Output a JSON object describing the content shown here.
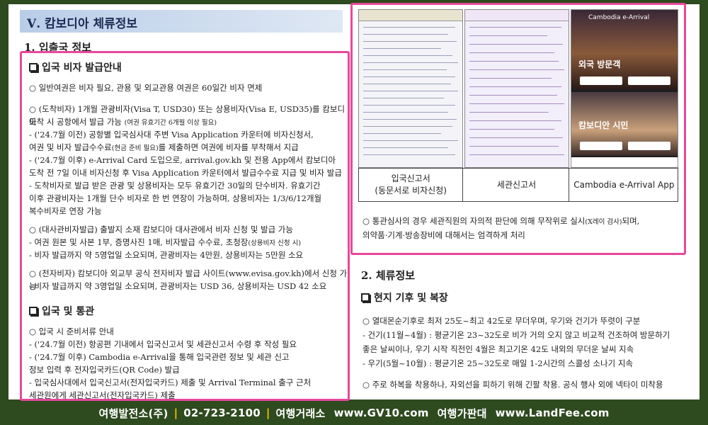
{
  "section_title": "Ⅴ. 캄보디아 체류정보",
  "left": {
    "heading_1": "1. 입출국 정보",
    "box_head_visa": "입국 비자 발급안내",
    "visa_lines": [
      "○  일반여권은 비자 필요, 관용 및 외교관용 여권은 60일간 비자 면제",
      "○  (도착비자) 1개월 관광비자(Visa T, USD30) 또는 상용비자(Visa E, USD35)를 캄보디아",
      "    도착 시 공항에서 발급 가능",
      "(여권 유효기간 6개월 이상 필요)",
      " - ('24.7월 이전) 공항별 입국심사대 주변 Visa Application 카운터에 비자신청서,",
      "   여권 및 비자 발급수수료",
      "(현금 준비 필요)",
      "를 제출하면 여권에 비자를 부착해서 지급",
      " - ('24.7월 이후) e-Arrival Card 도입으로, arrival.gov.kh 및 전용 App에서 캄보디아",
      "   도착 전 7일 이내 비자신청 후 Visa Application 카운터에서 발급수수료 지급 및 비자 발급",
      " - 도착비자로 발급 받은 관광 및 상용비자는 모두 유효기간 30일의 단수비자. 유효기간",
      "   이후 관광비자는 1개월 단수 비자로 한 번 연장이 가능하며, 상용비자는 1/3/6/12개월",
      "   복수비자로 연장 가능",
      "○  (대사관비자발급) 출발지 소재 캄보디아 대사관에서 비자 신청 및 발급 가능",
      " - 여권 원본 및 사본 1부, 증명사진 1매, 비자발급 수수료, 초청장",
      "(상용비자 신청 시)",
      " - 비자 발급까지 약 5영업일 소요되며, 관광비자는 4만원, 상용비자는 5만원 소요",
      "○  (전자비자) 캄보디아 외교부 공식 전자비자 발급 사이트(www.evisa.gov.kh)에서 신청 가능",
      " - 비자 발급까지 약 3영업일 소요되며, 관광비자는 USD 36, 상용비자는 USD 42 소요"
    ],
    "box_head_entry": "입국 및 통관",
    "entry_lines": [
      "○  입국 시 준비서류 안내",
      " - ('24.7월 이전) 항공편 기내에서 입국신고서 및 세관신고서 수령 후 작성 필요",
      " - ('24.7월 이후) Cambodia e-Arrival을 통해 입국관련 정보 및 세관 신고",
      "   정보 입력 후 전자입국카드(QR Code) 발급",
      " - 입국심사대에서 입국신고서(전자입국카드) 제출 및 Arrival Terminal 출구 근처",
      "   세관원에게 세관신고서(전자입국카드) 제출"
    ]
  },
  "right": {
    "app_header": "Cambodia e-Arrival",
    "app_visitor": "외국 방문객",
    "app_citizen": "캄보디안 시민",
    "captions": [
      "입국신고서\n(동문서로 비자신청)",
      "세관신고서",
      "Cambodia e-Arrival App"
    ],
    "customs_note_1": "○  통관심사의 경우 세관직원의 자의적 판단에 의해 무작위로 실시",
    "customs_note_small": "(X레이 검사)",
    "customs_note_2": "되며,",
    "customs_note_3": "의약품·기계·방송장비에 대해서는 엄격하게 처리",
    "heading_2": "2. 체류정보",
    "box_head_climate": "현지 기후 및 복장",
    "climate_lines": [
      "○  열대몬순기후로 최저 25도~최고 42도로 무더우며, 우기와 건기가 뚜렷이 구분",
      " - 건기(11월~4월) : 평균기온 23~32도로 비가 거의 오지 않고 비교적 건조하여 방문하기",
      "   좋은 날씨이나, 우기 시작 직전인 4월은 최고기온 42도 내외의 무더운 날씨 지속",
      " - 우기(5월~10월) : 평균기온 25~32도로 매일 1-2시간의 스콜성 소나기 지속",
      "○  주로 하복을 착용하나, 자외선을 피하기 위해 긴팔 착용. 공식 행사 외에 넥타이 미착용"
    ]
  },
  "footer": {
    "company": "여행발전소(주)",
    "phone": "02-723-2100",
    "site1_label": "여행거래소",
    "site1": "www.GV10.com",
    "site2_label": "여행가판대",
    "site2": "www.LandFee.com"
  },
  "colors": {
    "frame": "#2e4a1f",
    "highlight": "#e8489a",
    "accent": "#f5c400"
  }
}
